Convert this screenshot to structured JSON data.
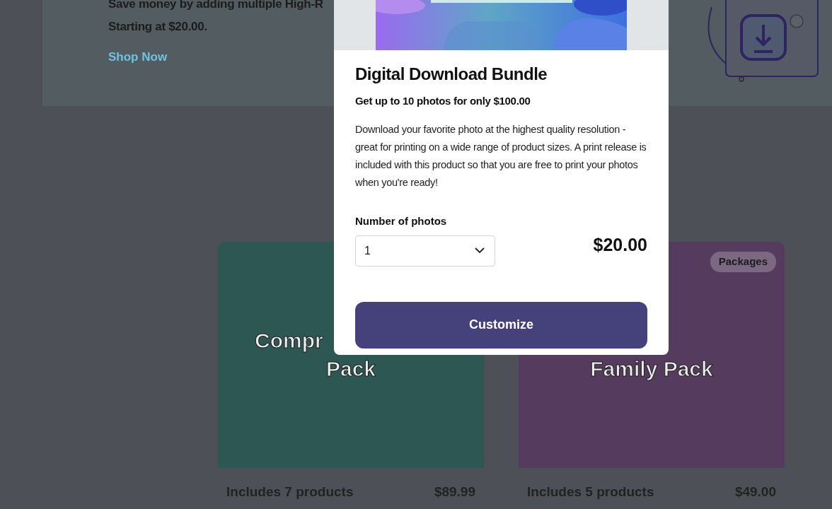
{
  "hero": {
    "text_lines": [
      "Save money by adding multiple High-R",
      "Starting at $20.00."
    ],
    "link": "Shop Now"
  },
  "cards": [
    {
      "title_lines": [
        "Compr",
        "Pack"
      ],
      "caption": "Includes 7 products",
      "price": "$89.99",
      "color": "#2c5753"
    },
    {
      "title_lines": [
        "Family Pack"
      ],
      "badge": "Packages",
      "caption": "Includes 5 products",
      "price": "$49.00",
      "color": "#553b5e"
    }
  ],
  "modal": {
    "title": "Digital Download Bundle",
    "subtitle": "Get up to 10 photos for only $100.00",
    "description": "Download your favorite photo at the highest quality resolution - great for printing on a wide range of product sizes. A print release is included with this product so that you are free to print your photos when you're ready!",
    "field_label": "Number of photos",
    "select_value": "1",
    "price": "$20.00",
    "button": "Customize"
  }
}
